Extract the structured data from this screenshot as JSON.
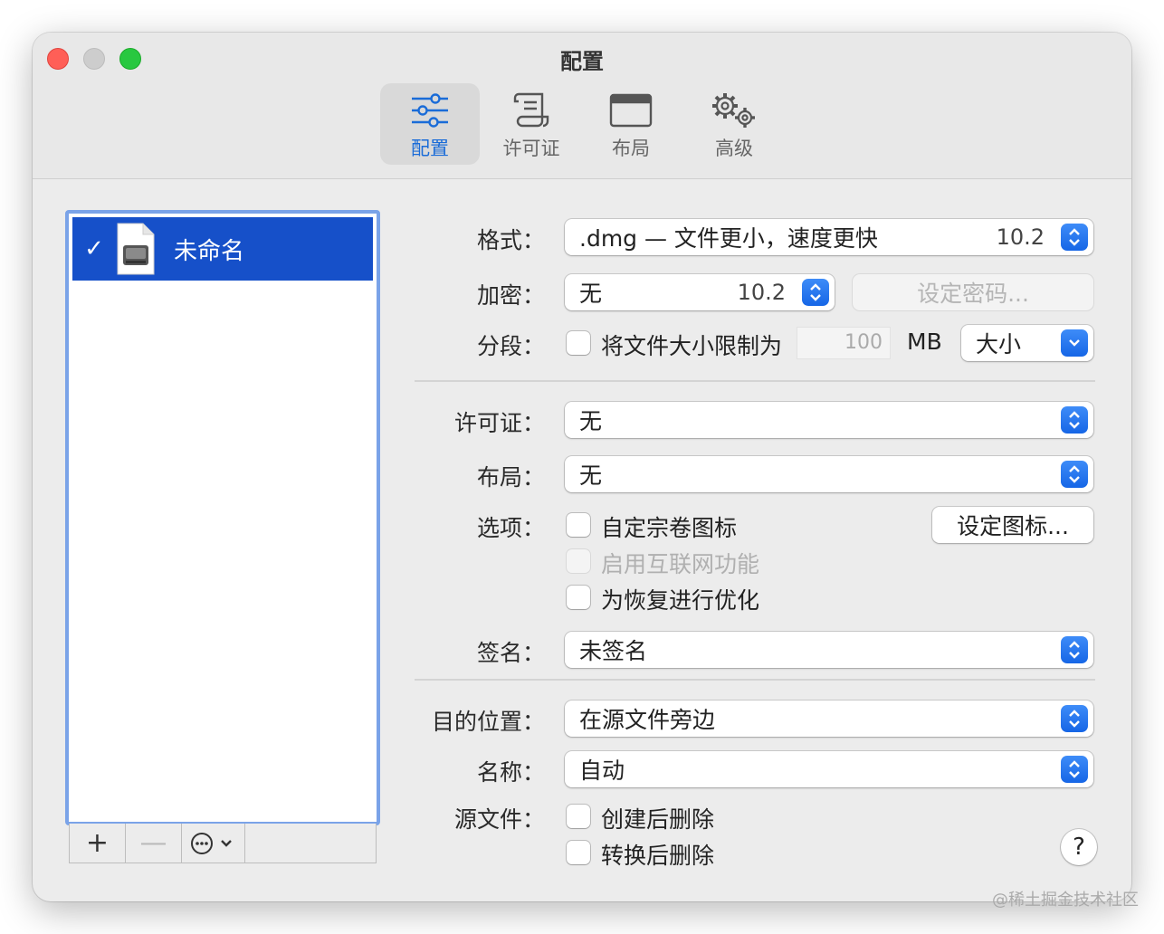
{
  "window": {
    "title": "配置"
  },
  "toolbar": {
    "tabs": [
      {
        "label": "配置",
        "icon": "sliders-icon",
        "active": true
      },
      {
        "label": "许可证",
        "icon": "scroll-icon",
        "active": false
      },
      {
        "label": "布局",
        "icon": "window-icon",
        "active": false
      },
      {
        "label": "高级",
        "icon": "gears-icon",
        "active": false
      }
    ]
  },
  "sidebar": {
    "items": [
      {
        "name": "未命名",
        "checked": "✓"
      }
    ],
    "add_label": "+",
    "remove_label": "—",
    "more_label": "⋯"
  },
  "form": {
    "format": {
      "label": "格式：",
      "value": ".dmg — 文件更小，速度更快",
      "version": "10.2"
    },
    "encryption": {
      "label": "加密：",
      "value": "无",
      "version": "10.2",
      "set_password": "设定密码..."
    },
    "segment": {
      "label": "分段：",
      "text": "将文件大小限制为",
      "size": "100",
      "unit": "MB",
      "unit_type": "大小"
    },
    "license": {
      "label": "许可证：",
      "value": "无"
    },
    "layout": {
      "label": "布局：",
      "value": "无"
    },
    "options": {
      "label": "选项：",
      "custom_icon": "自定宗卷图标",
      "set_icon_button": "设定图标...",
      "internet_enable": "启用互联网功能",
      "optimize_restore": "为恢复进行优化"
    },
    "signing": {
      "label": "签名：",
      "value": "未签名"
    },
    "destination": {
      "label": "目的位置：",
      "value": "在源文件旁边"
    },
    "name": {
      "label": "名称：",
      "value": "自动"
    },
    "source": {
      "label": "源文件：",
      "delete_after_create": "创建后删除",
      "delete_after_convert": "转换后删除"
    },
    "help_label": "?"
  },
  "watermark": "@稀土掘金技术社区",
  "colors": {
    "accent": "#1666e6",
    "selection": "#1650c9",
    "close": "#ff5f57",
    "maximize": "#28c840"
  }
}
